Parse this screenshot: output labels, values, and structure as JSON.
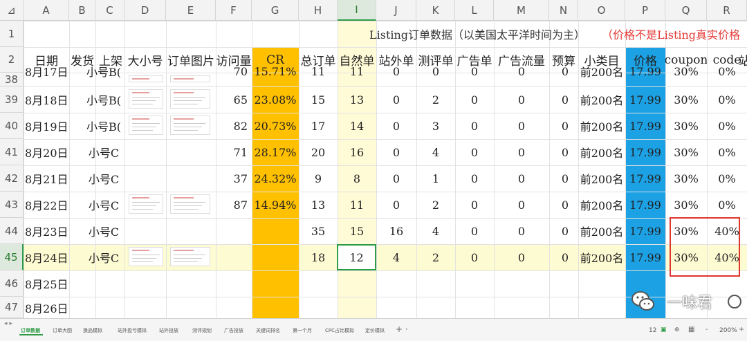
{
  "columns": [
    "A",
    "B",
    "C",
    "D",
    "E",
    "F",
    "G",
    "H",
    "I",
    "J",
    "K",
    "L",
    "M",
    "N",
    "O",
    "P",
    "Q",
    "R"
  ],
  "corner_mark": "⊿",
  "title_row": {
    "row_num": "1",
    "text": "Listing订单数据（以美国太平洋时间为主）",
    "note": "（价格不是Listing真实价格"
  },
  "header_row": {
    "row_num": "2",
    "labels": [
      "日期",
      "发货",
      "上架",
      "大小号",
      "订单图片",
      "访问量",
      "CR",
      "总订单",
      "自然单",
      "站外单",
      "测评单",
      "广告单",
      "广告流量",
      "预算",
      "小类目",
      "价格",
      "coupon",
      "code",
      "站"
    ]
  },
  "rows": [
    {
      "num": "38",
      "date": "8月17日",
      "account": "小号B(",
      "visits": "70",
      "cr": "15.71%",
      "total": "11",
      "natural": "11",
      "offsite": "0",
      "review": "0",
      "ad": "0",
      "adflow": "0",
      "budget": "0",
      "cat": "前200名",
      "price": "17.99",
      "coupon": "30%",
      "code": "0%",
      "thumbs": true
    },
    {
      "num": "39",
      "date": "8月18日",
      "account": "小号B(",
      "visits": "65",
      "cr": "23.08%",
      "total": "15",
      "natural": "13",
      "offsite": "0",
      "review": "2",
      "ad": "0",
      "adflow": "0",
      "budget": "0",
      "cat": "前200名",
      "price": "17.99",
      "coupon": "30%",
      "code": "0%",
      "thumbs": true
    },
    {
      "num": "40",
      "date": "8月19日",
      "account": "小号B(",
      "visits": "82",
      "cr": "20.73%",
      "total": "17",
      "natural": "14",
      "offsite": "0",
      "review": "3",
      "ad": "0",
      "adflow": "0",
      "budget": "0",
      "cat": "前200名",
      "price": "17.99",
      "coupon": "30%",
      "code": "0%",
      "thumbs": true
    },
    {
      "num": "41",
      "date": "8月20日",
      "account": "小号C",
      "visits": "71",
      "cr": "28.17%",
      "total": "20",
      "natural": "16",
      "offsite": "0",
      "review": "4",
      "ad": "0",
      "adflow": "0",
      "budget": "0",
      "cat": "前200名",
      "price": "17.99",
      "coupon": "30%",
      "code": "0%",
      "thumbs": false
    },
    {
      "num": "42",
      "date": "8月21日",
      "account": "小号C",
      "visits": "37",
      "cr": "24.32%",
      "total": "9",
      "natural": "8",
      "offsite": "0",
      "review": "1",
      "ad": "0",
      "adflow": "0",
      "budget": "0",
      "cat": "前200名",
      "price": "17.99",
      "coupon": "30%",
      "code": "0%",
      "thumbs": false
    },
    {
      "num": "43",
      "date": "8月22日",
      "account": "小号C",
      "visits": "87",
      "cr": "14.94%",
      "total": "13",
      "natural": "11",
      "offsite": "0",
      "review": "2",
      "ad": "0",
      "adflow": "0",
      "budget": "0",
      "cat": "前200名",
      "price": "17.99",
      "coupon": "30%",
      "code": "0%",
      "thumbs": true
    },
    {
      "num": "44",
      "date": "8月23日",
      "account": "小号C",
      "visits": "",
      "cr": "",
      "total": "35",
      "natural": "15",
      "offsite": "16",
      "review": "4",
      "ad": "0",
      "adflow": "0",
      "budget": "0",
      "cat": "前200名",
      "price": "17.99",
      "coupon": "30%",
      "code": "40%",
      "thumbs": false
    },
    {
      "num": "45",
      "date": "8月24日",
      "account": "小号C",
      "visits": "",
      "cr": "",
      "total": "18",
      "natural": "12",
      "offsite": "4",
      "review": "2",
      "ad": "0",
      "adflow": "0",
      "budget": "0",
      "cat": "前200名",
      "price": "17.99",
      "coupon": "30%",
      "code": "40%",
      "thumbs": true
    },
    {
      "num": "46",
      "date": "8月25日",
      "account": "",
      "visits": "",
      "cr": "",
      "total": "",
      "natural": "",
      "offsite": "",
      "review": "",
      "ad": "",
      "adflow": "",
      "budget": "",
      "cat": "",
      "price": "",
      "coupon": "",
      "code": "",
      "thumbs": false
    },
    {
      "num": "47",
      "date": "8月26日",
      "account": "",
      "visits": "",
      "cr": "",
      "total": "",
      "natural": "",
      "offsite": "",
      "review": "",
      "ad": "",
      "adflow": "",
      "budget": "",
      "cat": "",
      "price": "",
      "coupon": "",
      "code": "",
      "thumbs": false
    }
  ],
  "watermark": "一味君",
  "sheet_tabs": [
    "订单数据",
    "订单大图",
    "换品模拟",
    "站外盈亏模拟",
    "站外投放",
    "测评规划",
    "广告投放",
    "关键词排名",
    "第一个月",
    "CPC占比模拟",
    "定价模拟"
  ],
  "tab_add": "+",
  "tab_more": "·",
  "status": {
    "count": "12",
    "zoom": "200%",
    "minus": "-",
    "plus": "+"
  },
  "colors": {
    "cr_column": "#ffc000",
    "price_column": "#1ca1e4",
    "natural_column": "#fffbd6",
    "highlight_row": "#fdfbd2",
    "note_red": "#e53935",
    "accent_green": "#2e9b46",
    "box_red": "#e0352b"
  }
}
